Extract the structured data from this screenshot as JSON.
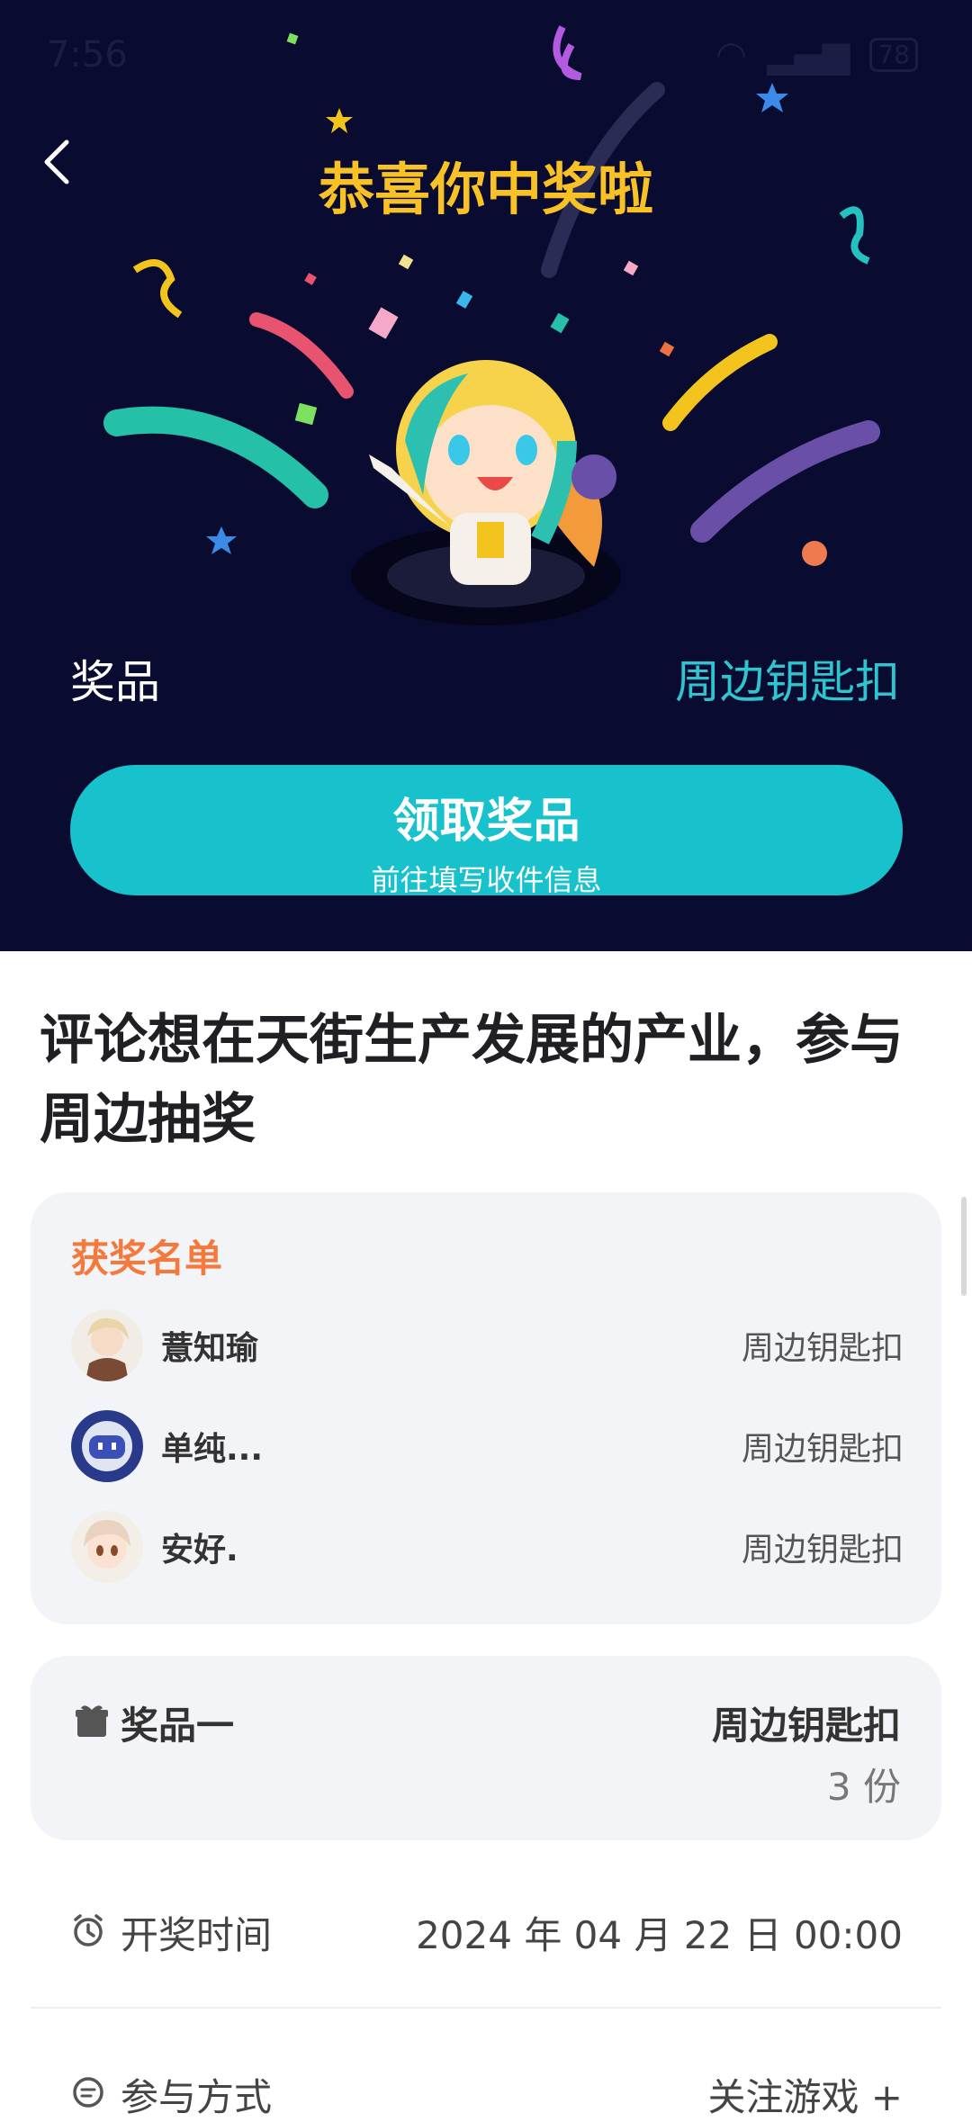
{
  "status_bar": {
    "time": "7:56",
    "battery": "78"
  },
  "header": {
    "title": "恭喜你中奖啦"
  },
  "prize_row": {
    "label": "奖品",
    "value": "周边钥匙扣"
  },
  "claim_button": {
    "label": "领取奖品",
    "sublabel": "前往填写收件信息"
  },
  "event": {
    "title": "评论想在天街生产发展的产业，参与周边抽奖"
  },
  "winners": {
    "heading": "获奖名单",
    "list": [
      {
        "name": "薏知瑜",
        "prize": "周边钥匙扣"
      },
      {
        "name": "单纯...",
        "prize": "周边钥匙扣"
      },
      {
        "name": "安好.",
        "prize": "周边钥匙扣"
      }
    ]
  },
  "prize_card": {
    "name": "奖品一",
    "item": "周边钥匙扣",
    "count": "3 份"
  },
  "draw_time": {
    "label": "开奖时间",
    "value": "2024 年 04 月 22 日 00:00"
  },
  "participation": {
    "label": "参与方式",
    "value": "关注游戏 +"
  },
  "colors": {
    "hero_bg": "#0a0b30",
    "accent": "#17c2cc",
    "title_yellow": "#f8c126",
    "winner_heading": "#f4793d"
  }
}
